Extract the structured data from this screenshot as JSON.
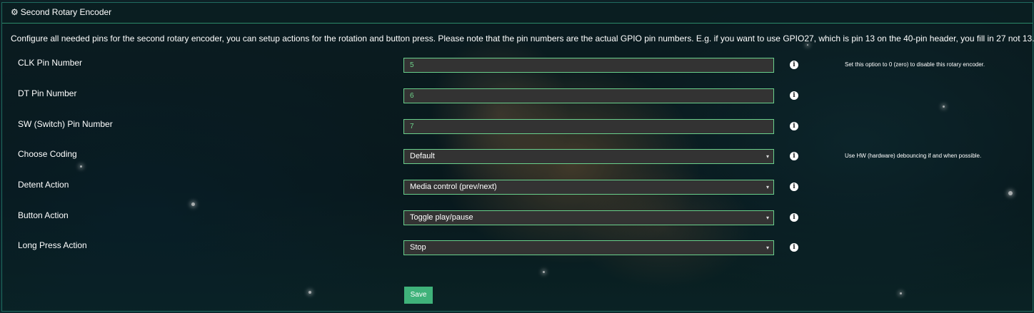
{
  "panel": {
    "title": "Second Rotary Encoder",
    "description": "Configure all needed pins for the second rotary encoder, you can setup actions for the rotation and button press. Please note that the pin numbers are the actual GPIO pin numbers. E.g. if you want to use GPIO27, which is pin 13 on the 40-pin header, you fill in 27 not 13."
  },
  "fields": {
    "clk": {
      "label": "CLK Pin Number",
      "value": "5",
      "hint": "Set this option to 0 (zero) to disable this rotary encoder."
    },
    "dt": {
      "label": "DT Pin Number",
      "value": "6"
    },
    "sw": {
      "label": "SW (Switch) Pin Number",
      "value": "7"
    },
    "coding": {
      "label": "Choose Coding",
      "value": "Default",
      "hint": "Use HW (hardware) debouncing if and when possible."
    },
    "detent": {
      "label": "Detent Action",
      "value": "Media control (prev/next)"
    },
    "button": {
      "label": "Button Action",
      "value": "Toggle play/pause"
    },
    "longpress": {
      "label": "Long Press Action",
      "value": "Stop"
    }
  },
  "info_icon": "i",
  "caret_icon": "▾",
  "gear_icon": "⚙",
  "save_label": "Save",
  "colors": {
    "accent": "#6ad08c",
    "save": "#3fb27a",
    "field_bg": "#333333"
  }
}
